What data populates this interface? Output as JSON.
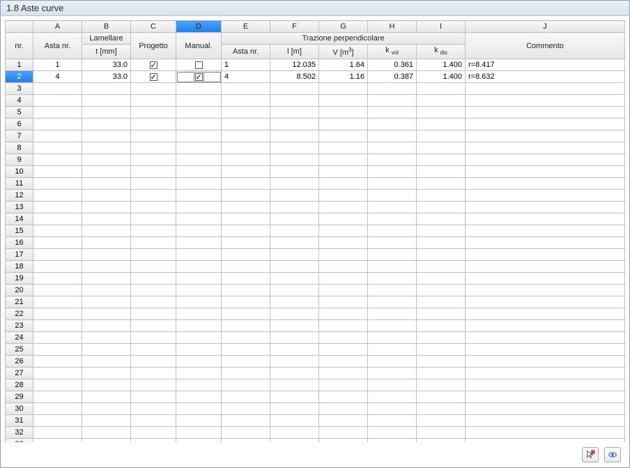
{
  "title": "1.8 Aste curve",
  "columns": {
    "letters": [
      "A",
      "B",
      "C",
      "D",
      "E",
      "F",
      "G",
      "H",
      "I",
      "J"
    ],
    "group_label": "Trazione perpendicolare",
    "labels": {
      "nr": "nr.",
      "A": "Asta nr.",
      "B_top": "Lamellare",
      "B_bot": "t [mm]",
      "C": "Progetto",
      "D": "Manual.",
      "E": "Asta nr.",
      "F": "l [m]",
      "G_html": "V [m<sup>3</sup>]",
      "H_html": "k <sub>vol</sub>",
      "I_html": "k <sub>dis</sub>",
      "J": "Commento"
    },
    "selected_letter_index": 3
  },
  "selected_row": 2,
  "selected_cell": {
    "row": 2,
    "col": "D"
  },
  "total_rows": 33,
  "rows": [
    {
      "nr": 1,
      "A": "1",
      "B": "33.0",
      "C": true,
      "D": false,
      "E": "1",
      "F": "12.035",
      "G": "1.64",
      "H": "0.361",
      "I": "1.400",
      "J": "r=8.417"
    },
    {
      "nr": 2,
      "A": "4",
      "B": "33.0",
      "C": true,
      "D": true,
      "E": "4",
      "F": "8.502",
      "G": "1.16",
      "H": "0.387",
      "I": "1.400",
      "J": "r=8.632"
    }
  ],
  "footer": {
    "pick_button": "pick",
    "view_button": "view"
  }
}
